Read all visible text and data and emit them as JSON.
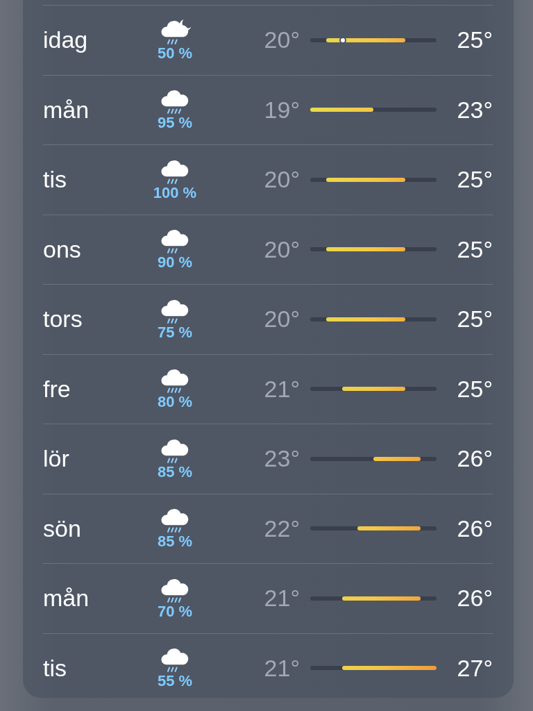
{
  "forecast": [
    {
      "day": "idag",
      "kind": "moon-rain",
      "precip": "50 %",
      "low": "20°",
      "high": "25°",
      "current": {
        "level": 0.26
      }
    },
    {
      "day": "mån",
      "kind": "heavy-rain",
      "precip": "95 %",
      "low": "19°",
      "high": "23°"
    },
    {
      "day": "tis",
      "kind": "rain",
      "precip": "100 %",
      "low": "20°",
      "high": "25°"
    },
    {
      "day": "ons",
      "kind": "rain",
      "precip": "90 %",
      "low": "20°",
      "high": "25°"
    },
    {
      "day": "tors",
      "kind": "rain",
      "precip": "75 %",
      "low": "20°",
      "high": "25°"
    },
    {
      "day": "fre",
      "kind": "heavy-rain",
      "precip": "80 %",
      "low": "21°",
      "high": "25°"
    },
    {
      "day": "lör",
      "kind": "rain",
      "precip": "85 %",
      "low": "23°",
      "high": "26°"
    },
    {
      "day": "sön",
      "kind": "heavy-rain",
      "precip": "85 %",
      "low": "22°",
      "high": "26°"
    },
    {
      "day": "mån",
      "kind": "heavy-rain",
      "precip": "70 %",
      "low": "21°",
      "high": "26°"
    },
    {
      "day": "tis",
      "kind": "rain",
      "precip": "55 %",
      "low": "21°",
      "high": "27°"
    }
  ]
}
